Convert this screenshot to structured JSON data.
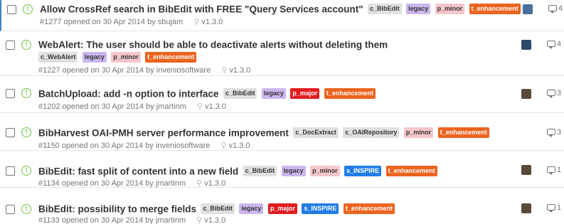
{
  "label_colors": {
    "c_BibEdit": {
      "bg": "#e0e0e0",
      "fg": "#333333"
    },
    "c_WebAlert": {
      "bg": "#e0e0e0",
      "fg": "#333333"
    },
    "c_DocExtract": {
      "bg": "#e0e0e0",
      "fg": "#333333"
    },
    "c_OAIRepository": {
      "bg": "#e0e0e0",
      "fg": "#333333"
    },
    "legacy": {
      "bg": "#cbb6ee",
      "fg": "#333333"
    },
    "p_minor": {
      "bg": "#f5c6cb",
      "fg": "#333333"
    },
    "p_major": {
      "bg": "#e11d21",
      "fg": "#ffffff"
    },
    "s_INSPIRE": {
      "bg": "#207de5",
      "fg": "#ffffff"
    },
    "t_enhancement": {
      "bg": "#eb6420",
      "fg": "#ffffff"
    }
  },
  "issues": [
    {
      "title": "Allow CrossRef search in BibEdit with FREE \"Query Services account\"",
      "labels": [
        "c_BibEdit",
        "legacy",
        "p_minor",
        "t_enhancement"
      ],
      "meta": "#1277 opened on 30 Apr 2014 by sbujam",
      "milestone": "v1.3.0",
      "comments": "4",
      "avatar": "avatar-icon",
      "avatar_color": "#4a6f9a"
    },
    {
      "title": "WebAlert: The user should be able to deactivate alerts without deleting them",
      "labels": [
        "c_WebAlert",
        "legacy",
        "p_minor",
        "t_enhancement"
      ],
      "meta": "#1227 opened on 30 Apr 2014 by inveniosoftware",
      "milestone": "v1.3.0",
      "comments": "4",
      "avatar": "avatar-icon",
      "avatar_color": "#2c4a6a"
    },
    {
      "title": "BatchUpload: add -n option to interface",
      "labels": [
        "c_BibEdit",
        "legacy",
        "p_major",
        "t_enhancement"
      ],
      "meta": "#1202 opened on 30 Apr 2014 by jmartinm",
      "milestone": "v1.3.0",
      "comments": "3",
      "avatar": "avatar-icon",
      "avatar_color": "#5a4a3a"
    },
    {
      "title": "BibHarvest OAI-PMH server performance improvement",
      "labels": [
        "c_DocExtract",
        "c_OAIRepository",
        "p_minor",
        "t_enhancement"
      ],
      "meta": "#1150 opened on 30 Apr 2014 by inveniosoftware",
      "milestone": "v1.3.0",
      "comments": "3",
      "avatar": "",
      "avatar_color": ""
    },
    {
      "title": "BibEdit: fast split of content into a new field",
      "labels": [
        "c_BibEdit",
        "legacy",
        "p_minor",
        "s_INSPIRE",
        "t_enhancement"
      ],
      "meta": "#1134 opened on 30 Apr 2014 by jmartinm",
      "milestone": "v1.3.0",
      "comments": "1",
      "avatar": "avatar-icon",
      "avatar_color": "#5a4a3a"
    },
    {
      "title": "BibEdit: possibility to merge fields",
      "labels": [
        "c_BibEdit",
        "legacy",
        "p_major",
        "s_INSPIRE",
        "t_enhancement"
      ],
      "meta": "#1133 opened on 30 Apr 2014 by jmartinm",
      "milestone": "v1.3.0",
      "comments": "1",
      "avatar": "avatar-icon",
      "avatar_color": "#5a4a3a"
    }
  ]
}
